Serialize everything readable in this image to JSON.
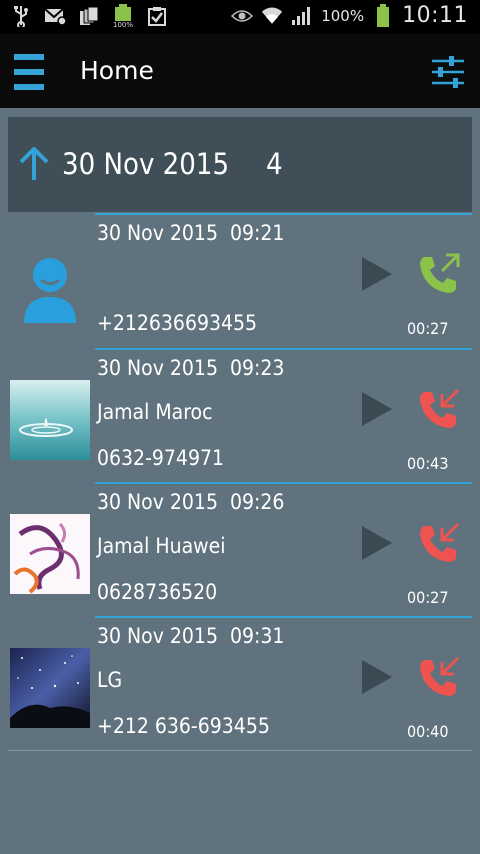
{
  "status_bar": {
    "battery_percent": "100%",
    "time": "10:11",
    "icons": [
      "usb-icon",
      "message-icon",
      "sim-cards-icon",
      "battery-full-icon",
      "clipboard-check-icon",
      "eye-icon",
      "wifi-icon",
      "signal-icon",
      "battery-icon"
    ]
  },
  "app_bar": {
    "title": "Home"
  },
  "group": {
    "date": "30 Nov 2015",
    "count": "4"
  },
  "calls": [
    {
      "datetime": "30 Nov 2015  09:21",
      "name": "",
      "number": "+212636693455",
      "duration": "00:27",
      "type": "outgoing",
      "avatar": "default-contact"
    },
    {
      "datetime": "30 Nov 2015  09:23",
      "name": "Jamal Maroc",
      "number": "0632-974971",
      "duration": "00:43",
      "type": "incoming",
      "avatar": "water-drop-photo"
    },
    {
      "datetime": "30 Nov 2015  09:26",
      "name": "Jamal Huawei",
      "number": "0628736520",
      "duration": "00:27",
      "type": "incoming",
      "avatar": "abstract-ink-photo"
    },
    {
      "datetime": "30 Nov 2015  09:31",
      "name": "LG",
      "number": "+212 636-693455",
      "duration": "00:40",
      "type": "incoming",
      "avatar": "starry-sky-photo"
    }
  ],
  "colors": {
    "accent": "#34a3d8",
    "outgoing": "#8bc34a",
    "incoming": "#ef5350",
    "background": "#5f727d",
    "header": "#3f4e57"
  }
}
